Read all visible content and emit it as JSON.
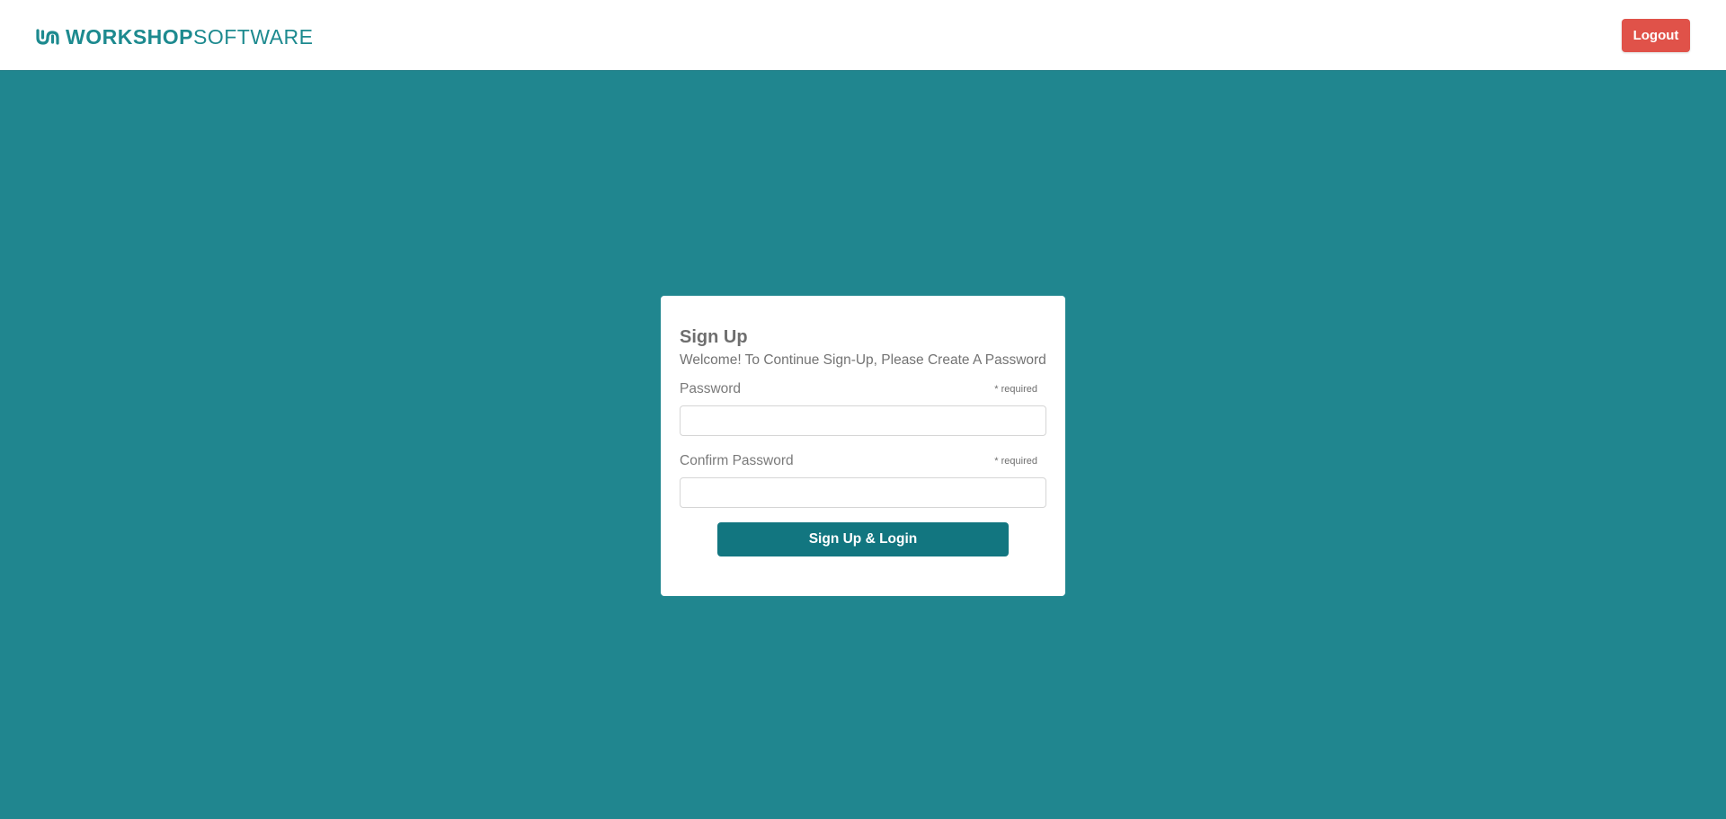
{
  "header": {
    "logo": {
      "icon": "workshop-software-logo-icon",
      "bold_text": "WORKSHOP",
      "light_text": "SOFTWARE"
    },
    "logout_label": "Logout"
  },
  "signup": {
    "title": "Sign Up",
    "subtitle": "Welcome! To Continue Sign-Up, Please Create A Password",
    "password": {
      "label": "Password",
      "required_note": "* required",
      "value": "",
      "placeholder": ""
    },
    "confirm_password": {
      "label": "Confirm Password",
      "required_note": "* required",
      "value": "",
      "placeholder": ""
    },
    "submit_label": "Sign Up & Login"
  },
  "colors": {
    "page_background": "#20868f",
    "brand_teal": "#1d8a8f",
    "logout_red": "#e05249",
    "submit_teal": "#127680"
  }
}
